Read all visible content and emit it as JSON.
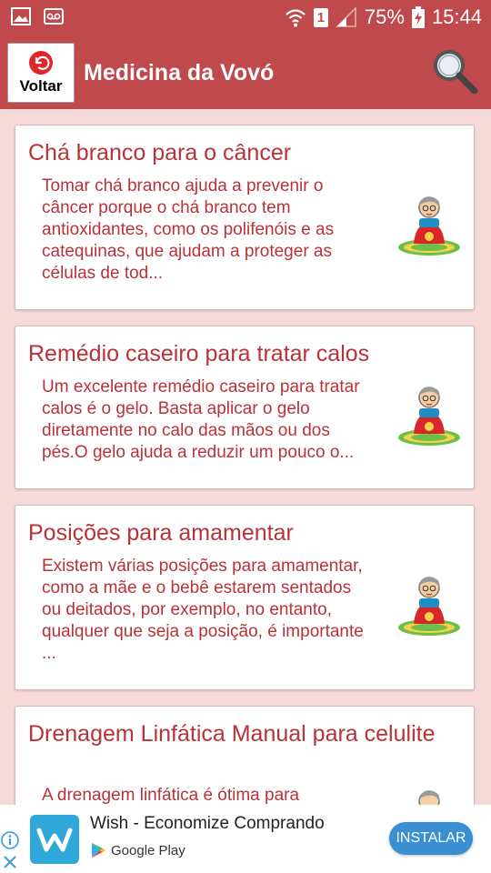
{
  "status_bar": {
    "battery": "75%",
    "time": "15:44",
    "sim_slot": "1"
  },
  "app_bar": {
    "back_label": "Voltar",
    "title": "Medicina da Vovó"
  },
  "cards": [
    {
      "title": "Chá branco para o câncer",
      "description": "Tomar chá branco ajuda a prevenir o câncer porque o chá branco tem antioxidantes, como os polifenóis e as catequinas, que ajudam a proteger as células de tod..."
    },
    {
      "title": "Remédio caseiro para tratar calos",
      "description": "Um excelente remédio caseiro para tratar calos é o gelo. Basta aplicar o gelo diretamente no calo das mãos ou dos pés.O gelo ajuda a reduzir um pouco o..."
    },
    {
      "title": "Posições para amamentar",
      "description": "Existem várias posições para amamentar, como a mãe e o bebê estarem sentados ou deitados, por exemplo, no entanto, qualquer que seja a posição, é importante ..."
    },
    {
      "title": "Drenagem Linfática Manual para celulite",
      "description": "A drenagem linfática é ótima para"
    }
  ],
  "ad": {
    "title": "Wish - Economize Comprando",
    "store": "Google Play",
    "install_label": "INSTALAR"
  },
  "colors": {
    "app_bar": "#c0494b",
    "text_red": "#b8323a",
    "background": "#f6d9d9",
    "install_button": "#3a8fd0"
  }
}
